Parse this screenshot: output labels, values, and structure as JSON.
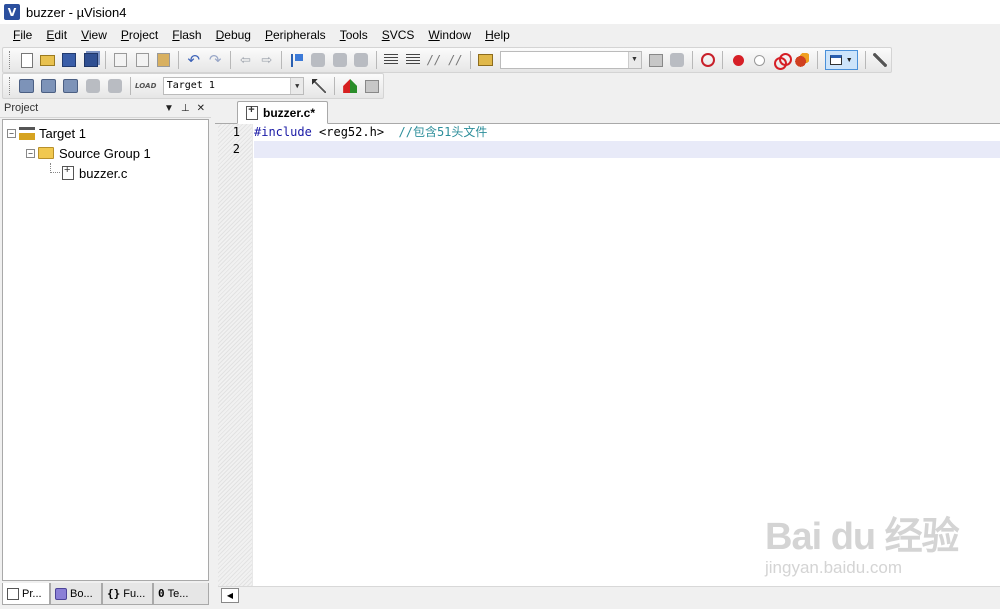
{
  "window": {
    "title": "buzzer  - µVision4"
  },
  "menu": {
    "items": [
      {
        "label": "File"
      },
      {
        "label": "Edit"
      },
      {
        "label": "View"
      },
      {
        "label": "Project"
      },
      {
        "label": "Flash"
      },
      {
        "label": "Debug"
      },
      {
        "label": "Peripherals"
      },
      {
        "label": "Tools"
      },
      {
        "label": "SVCS"
      },
      {
        "label": "Window"
      },
      {
        "label": "Help"
      }
    ]
  },
  "build_toolbar": {
    "target": "Target 1",
    "load_label": "LOAD"
  },
  "project_panel": {
    "title": "Project",
    "tree": {
      "target": "Target 1",
      "group": "Source Group 1",
      "file": "buzzer.c"
    },
    "tabs": [
      {
        "label": "Pr..."
      },
      {
        "label": "Bo..."
      },
      {
        "label": "Fu...",
        "prefix": "{}"
      },
      {
        "label": "Te...",
        "prefix": "0"
      }
    ]
  },
  "editor": {
    "tab": "buzzer.c*",
    "lines": [
      {
        "no": "1",
        "directive": "#include",
        "text": " <reg52.h>  ",
        "comment": "//包含51头文件"
      },
      {
        "no": "2",
        "directive": "",
        "text": "",
        "comment": ""
      }
    ]
  },
  "watermark": {
    "brand": "Bai du 经验",
    "site": "jingyan.baidu.com"
  }
}
